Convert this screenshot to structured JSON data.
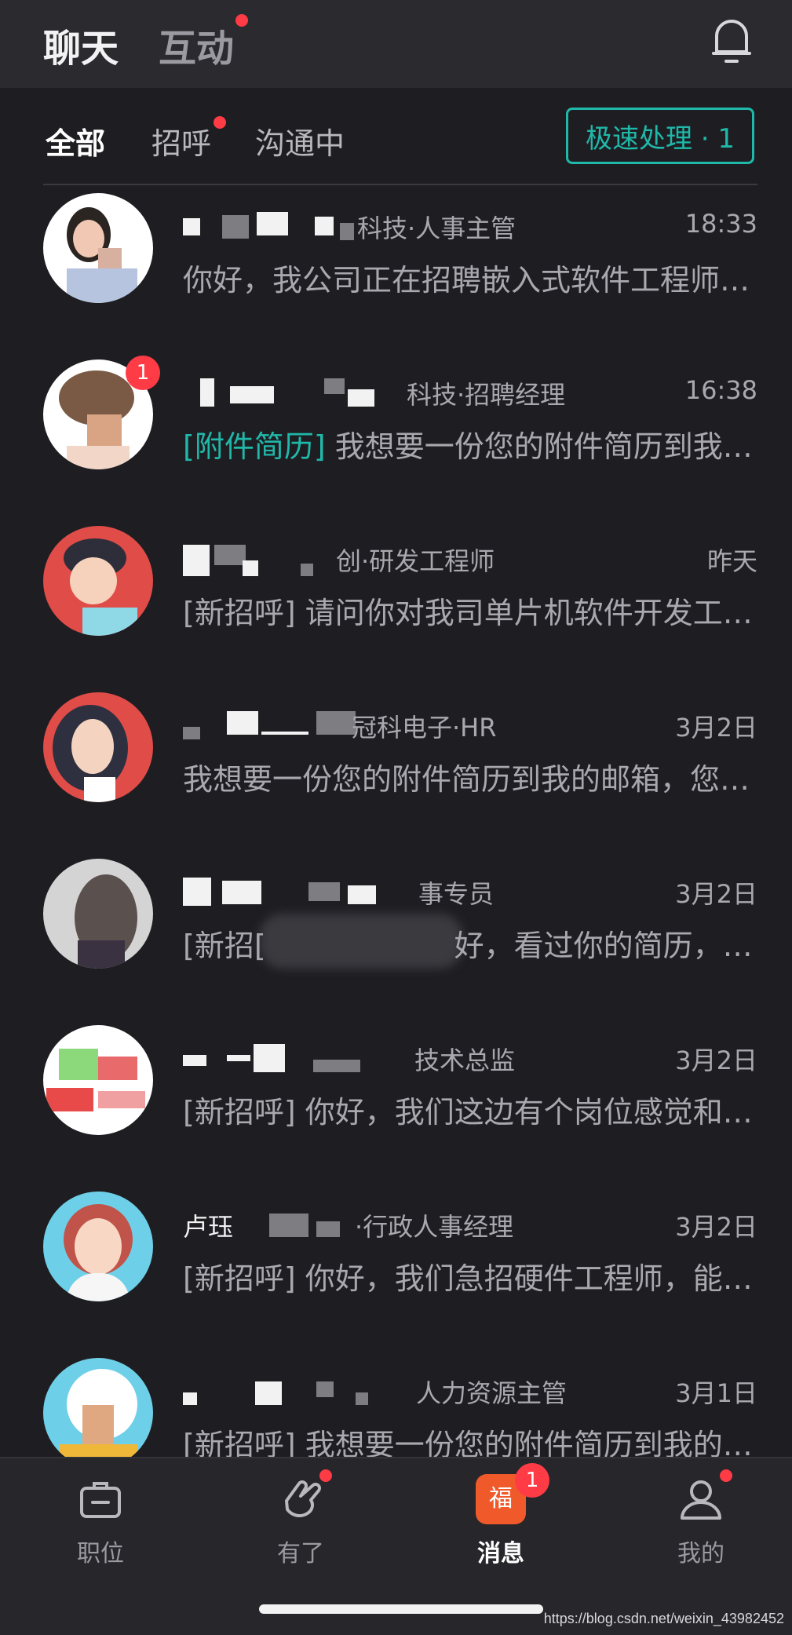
{
  "header": {
    "tabs": [
      {
        "label": "聊天",
        "active": true
      },
      {
        "label": "互动",
        "active": false,
        "has_dot": true
      }
    ],
    "bell_icon": "bell-icon"
  },
  "filters": {
    "tabs": [
      {
        "label": "全部",
        "active": true
      },
      {
        "label": "招呼",
        "has_dot": true
      },
      {
        "label": "沟通中"
      }
    ],
    "fast_button": "极速处理 · 1"
  },
  "chats": [
    {
      "title_suffix": "科技·人事主管",
      "time": "18:33",
      "preview": "你好，我公司正在招聘嵌入式软件工程师，…",
      "unread": ""
    },
    {
      "title_suffix": "科技·招聘经理",
      "time": "16:38",
      "preview_tag": "[附件简历]",
      "preview": " 我想要一份您的附件简历到我的…",
      "unread": "1"
    },
    {
      "title_suffix": "创·研发工程师",
      "time": "昨天",
      "preview": "[新招呼] 请问你对我司单片机软件开发工程…",
      "unread": ""
    },
    {
      "title_suffix": "冠科电子·HR",
      "time": "3月2日",
      "preview": "我想要一份您的附件简历到我的邮箱，您是…",
      "unread": ""
    },
    {
      "title_suffix": "事专员",
      "time": "3月2日",
      "preview_start": "[新招[",
      "preview": "好，看过你的简历，方…",
      "unread": ""
    },
    {
      "title_suffix": "技术总监",
      "time": "3月2日",
      "preview": "[新招呼] 你好，我们这边有个岗位感觉和你…",
      "unread": ""
    },
    {
      "name_visible": "卢珏",
      "title_suffix": "·行政人事经理",
      "time": "3月2日",
      "preview": "[新招呼] 你好，我们急招硬件工程师，能和…",
      "unread": ""
    },
    {
      "title_suffix": "人力资源主管",
      "time": "3月1日",
      "preview": "[新招呼] 我想要一份您的附件简历到我的邮…",
      "unread": ""
    }
  ],
  "nav": [
    {
      "label": "职位",
      "icon": "briefcase-icon"
    },
    {
      "label": "有了",
      "icon": "hand-icon",
      "has_dot": true
    },
    {
      "label": "消息",
      "icon": "fortune-bag-icon",
      "active": true,
      "badge": "1",
      "icon_text": "福"
    },
    {
      "label": "我的",
      "icon": "user-icon",
      "has_dot": true
    }
  ],
  "watermark": "https://blog.csdn.net/weixin_43982452",
  "colors": {
    "accent": "#1fb8a9",
    "badge": "#ff3b46",
    "background": "#1e1e22"
  }
}
